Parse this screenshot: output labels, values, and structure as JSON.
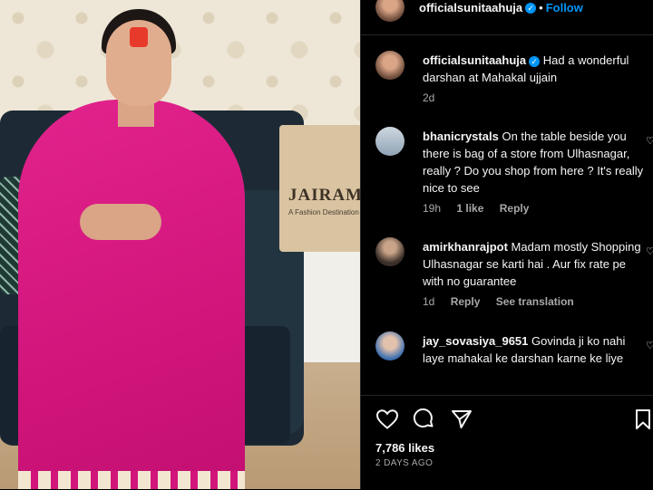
{
  "post": {
    "author": "officialsunitaahuja",
    "follow_label": "Follow",
    "separator": "•",
    "caption": "Had a wonderful darshan at Mahakal ujjain",
    "caption_age": "2d",
    "likes": "7,786 likes",
    "date": "2 DAYS AGO"
  },
  "photo": {
    "bag_store_name": "JAIRAM",
    "bag_store_tagline": "A Fashion Destination"
  },
  "comments": [
    {
      "user": "bhanicrystals",
      "text": "On the table beside you there is bag of a store from Ulhasnagar, really ? Do you shop from here ? It's really nice to see",
      "age": "19h",
      "likes": "1 like",
      "reply": "Reply"
    },
    {
      "user": "amirkhanrajpot",
      "text": "Madam mostly Shopping Ulhasnagar se karti hai . Aur fix rate pe with no guarantee",
      "age": "1d",
      "reply": "Reply",
      "translate": "See translation"
    },
    {
      "user": "jay_sovasiya_9651",
      "text": "Govinda ji ko nahi laye mahakal ke darshan karne ke liye"
    }
  ],
  "icons": {
    "like": "heart-icon",
    "comment": "comment-icon",
    "share": "share-icon",
    "save": "bookmark-icon"
  },
  "colors": {
    "accent": "#0095f6",
    "saree": "#d1157b",
    "muted_text": "#a8a8a8"
  }
}
